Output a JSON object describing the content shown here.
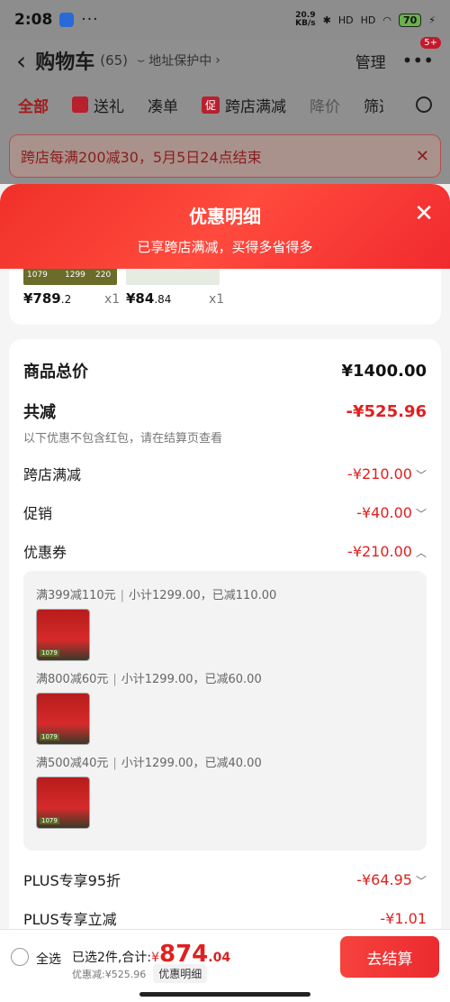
{
  "status_bar": {
    "time": "2:08",
    "dots": "···",
    "speed_top": "20.9",
    "speed_bottom": "KB/s",
    "signal1": "HD",
    "signal2": "HD",
    "battery": "70"
  },
  "nav": {
    "title": "购物车",
    "count": "(65)",
    "address": "地址保护中",
    "manage": "管理",
    "badge": "5+"
  },
  "filters": {
    "all": "全部",
    "gift": "送礼",
    "bundle": "凑单",
    "promo_icon": "促",
    "cross_store": "跨店满减",
    "price_drop": "降价",
    "filter": "筛选"
  },
  "banner": {
    "text": "跨店每满200减30，5月5日24点结束"
  },
  "sheet": {
    "title": "优惠明细",
    "subtitle": "已享跨店满减，买得多省得多"
  },
  "products": [
    {
      "price_main": "¥789",
      "price_dec": ".2",
      "qty": "x1",
      "tag_a": "1079",
      "tag_b": "1299",
      "tag_c": "220"
    },
    {
      "price_main": "¥84",
      "price_dec": ".84",
      "qty": "x1"
    }
  ],
  "details": {
    "total_label": "商品总价",
    "total_value": "¥1400.00",
    "reduce_label": "共减",
    "reduce_value": "-¥525.96",
    "note": "以下优惠不包含红包，请在结算页查看",
    "cross_label": "跨店满减",
    "cross_value": "-¥210.00",
    "promo_label": "促销",
    "promo_value": "-¥40.00",
    "coupon_label": "优惠券",
    "coupon_value": "-¥210.00",
    "plus95_label": "PLUS专享95折",
    "plus95_value": "-¥64.95",
    "plus_label": "PLUS专享立减",
    "plus_value": "-¥1.01"
  },
  "coupons": [
    {
      "rule": "满399减110元",
      "detail": "小计1299.00，已减110.00",
      "tag": "1079"
    },
    {
      "rule": "满800减60元",
      "detail": "小计1299.00，已减60.00",
      "tag": "1079"
    },
    {
      "rule": "满500减40元",
      "detail": "小计1299.00，已减40.00",
      "tag": "1079"
    }
  ],
  "bottom": {
    "select_all": "全选",
    "selected": "已选2件,合计:",
    "currency": "¥",
    "total_int": "874",
    "total_dec": ".04",
    "discount": "优惠减:¥525.96",
    "detail_btn": "优惠明细",
    "checkout": "去结算"
  }
}
